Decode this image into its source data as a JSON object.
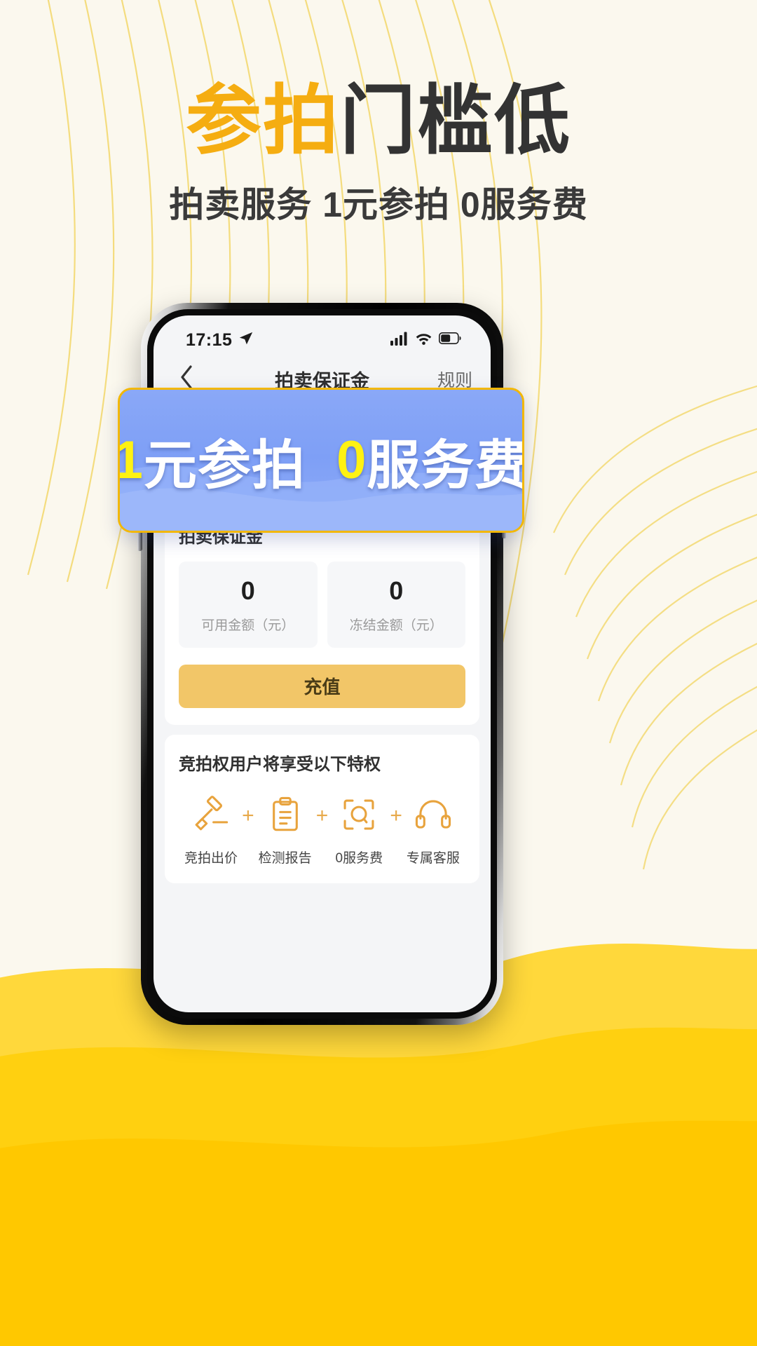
{
  "poster": {
    "headline_highlight": "参拍",
    "headline_rest": "门槛低",
    "subheadline": "拍卖服务  1元参拍  0服务费",
    "headline_highlight_color": "#F5AD11",
    "headline_rest_color": "#333333",
    "background_color": "#FBF8EE",
    "accent_color": "#FFD400"
  },
  "promo_banner": {
    "part1_number": "1",
    "part1_text": "元参拍",
    "part2_number": "0",
    "part2_text": "服务费",
    "full_text": "1元参拍 0服务费",
    "number_color": "#FFF212",
    "text_color": "#FFFFFF",
    "background_color": "#7E9FF6",
    "border_color": "#F2B705"
  },
  "phone": {
    "status_bar": {
      "time": "17:15",
      "location_icon": "location-arrow-icon",
      "signal_icon": "cellular-signal-icon",
      "wifi_icon": "wifi-icon",
      "battery_icon": "battery-icon"
    },
    "nav_bar": {
      "back_icon": "chevron-left-icon",
      "title": "拍卖保证金",
      "right_action": "规则"
    },
    "deposit_card": {
      "title": "拍卖保证金",
      "amounts": [
        {
          "value": "0",
          "label": "可用金额（元）"
        },
        {
          "value": "0",
          "label": "冻结金额（元）"
        }
      ],
      "recharge_button": "充值",
      "recharge_button_color": "#F2C668"
    },
    "privileges_card": {
      "title": "竞拍权用户将享受以下特权",
      "separator": "+",
      "items": [
        {
          "icon": "gavel-icon",
          "label": "竞拍出价"
        },
        {
          "icon": "clipboard-report-icon",
          "label": "检测报告"
        },
        {
          "icon": "scan-zero-fee-icon",
          "label": "0服务费"
        },
        {
          "icon": "headset-support-icon",
          "label": "专属客服"
        }
      ]
    }
  }
}
